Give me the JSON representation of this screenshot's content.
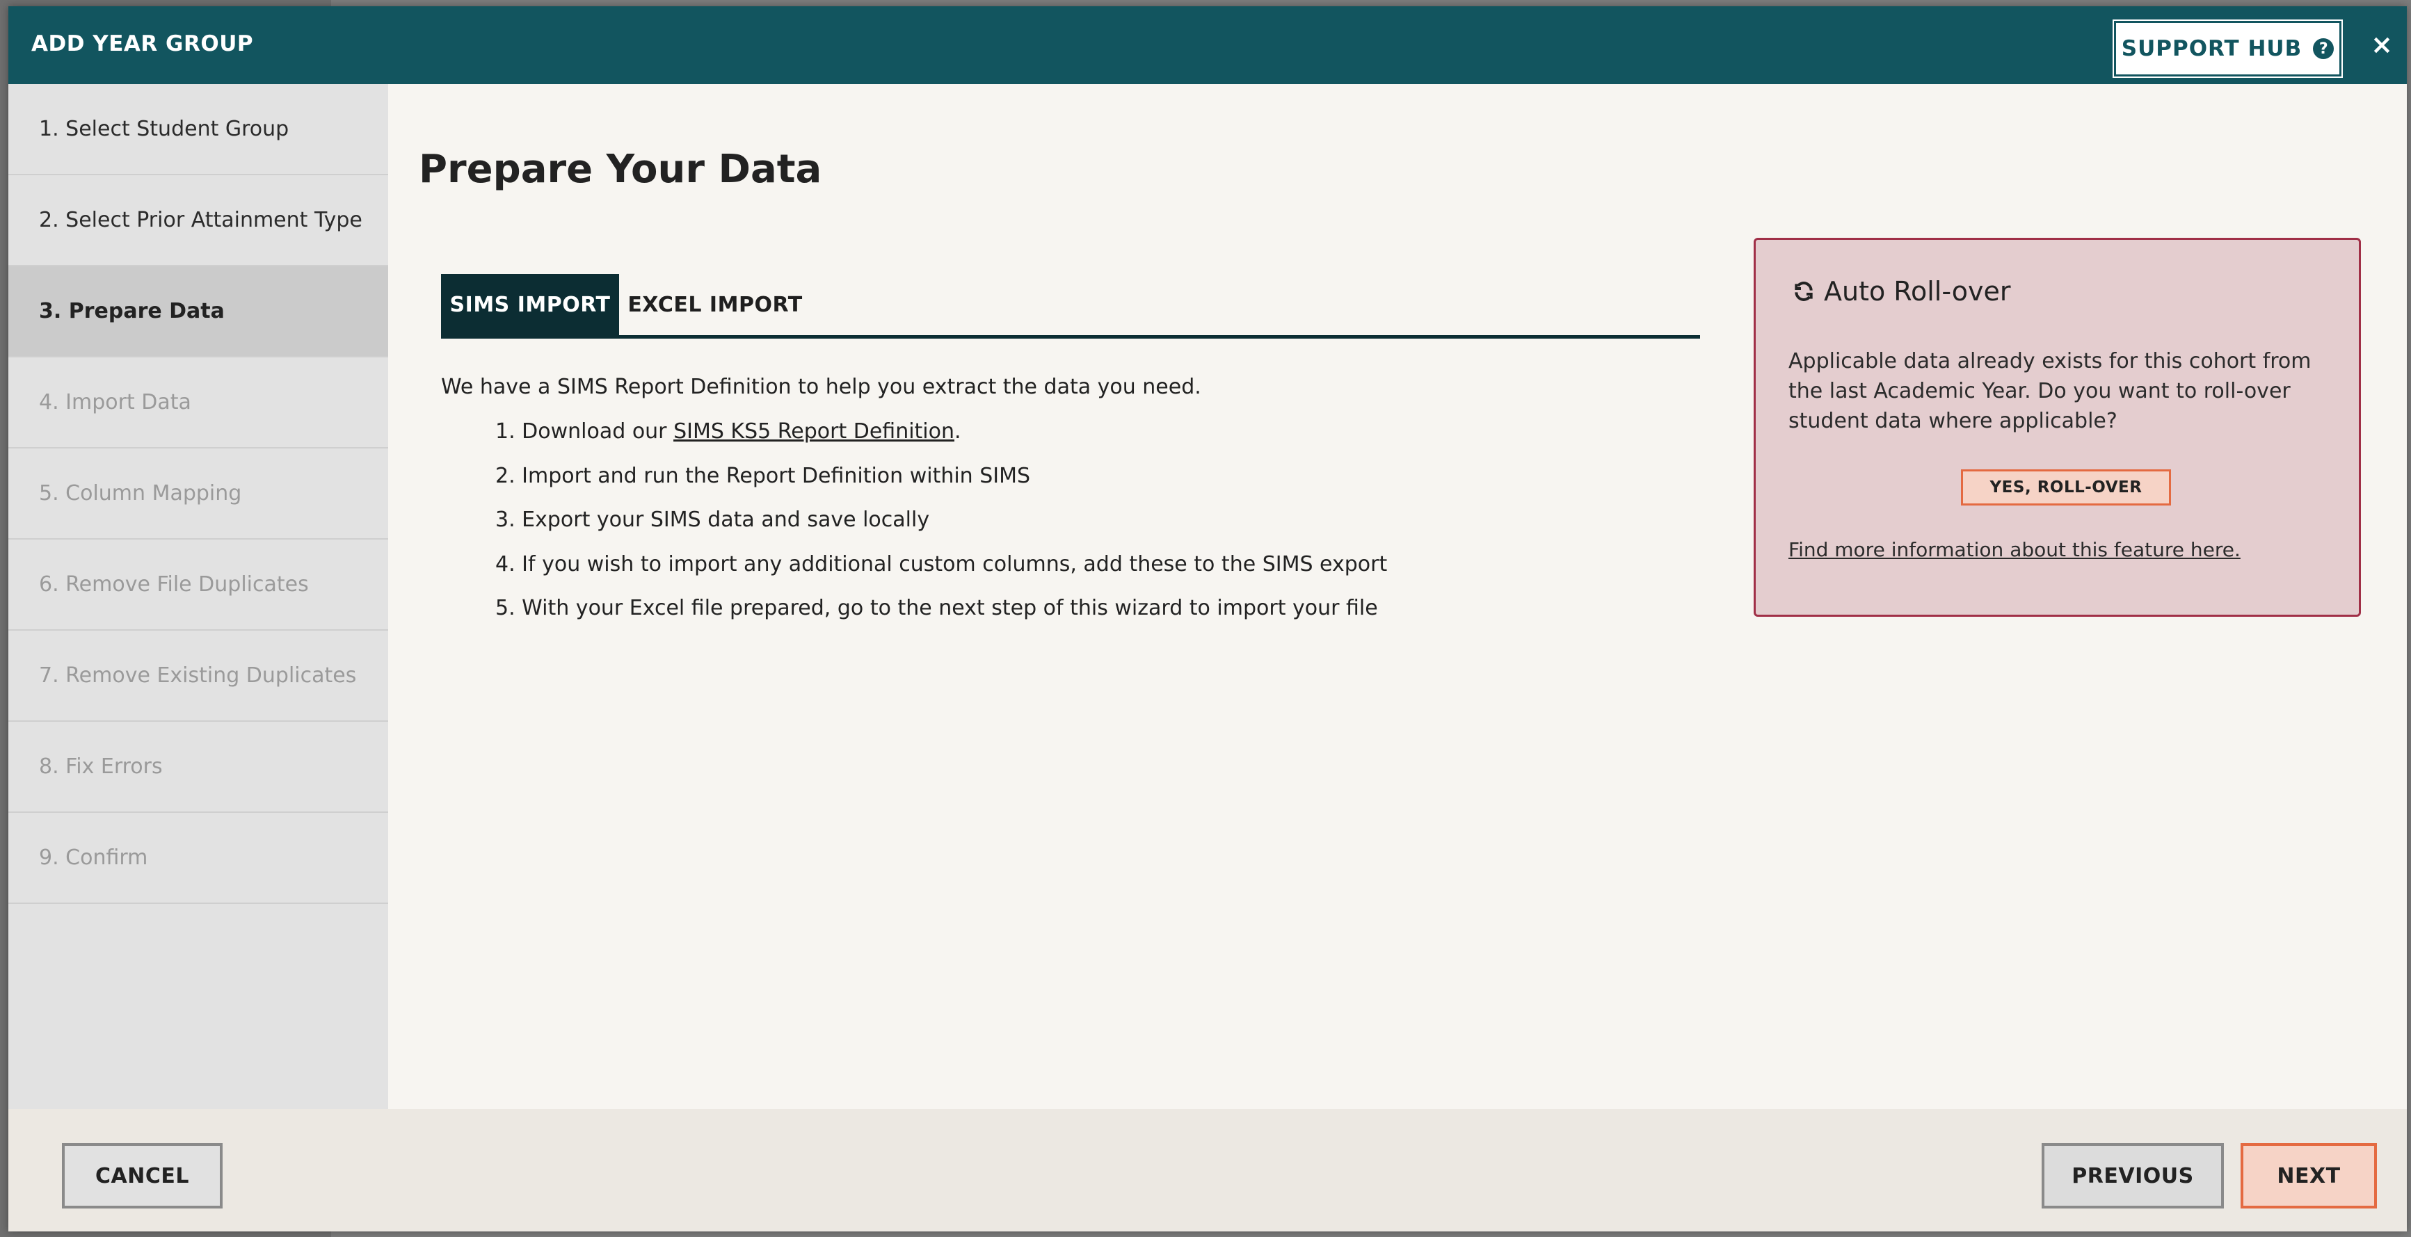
{
  "dialog": {
    "title": "ADD YEAR GROUP",
    "support_label": "SUPPORT HUB",
    "close_label": "×"
  },
  "steps": [
    {
      "label": "1. Select Student Group",
      "state": "done"
    },
    {
      "label": "2. Select Prior Attainment Type",
      "state": "done"
    },
    {
      "label": "3. Prepare Data",
      "state": "active"
    },
    {
      "label": "4. Import Data",
      "state": "disabled"
    },
    {
      "label": "5. Column Mapping",
      "state": "disabled"
    },
    {
      "label": "6. Remove File Duplicates",
      "state": "disabled"
    },
    {
      "label": "7. Remove Existing Duplicates",
      "state": "disabled"
    },
    {
      "label": "8. Fix Errors",
      "state": "disabled"
    },
    {
      "label": "9. Confirm",
      "state": "disabled"
    }
  ],
  "main": {
    "title": "Prepare Your Data",
    "tabs": [
      {
        "label": "SIMS IMPORT",
        "active": true
      },
      {
        "label": "EXCEL IMPORT",
        "active": false
      }
    ],
    "intro": "We have a SIMS Report Definition to help you extract the data you need.",
    "instructions": {
      "step1_prefix": "1. Download our ",
      "step1_link": "SIMS KS5 Report Definition",
      "step1_suffix": ".",
      "step2": "2. Import and run the Report Definition within SIMS",
      "step3": "3. Export your SIMS data and save locally",
      "step4": "4. If you wish to import any additional custom columns, add these to the SIMS export",
      "step5": "5. With your Excel file prepared, go to the next step of this wizard to import your file"
    }
  },
  "rollover": {
    "icon": "refresh-icon",
    "title": "Auto Roll-over",
    "text": "Applicable data already exists for this cohort from the last Academic Year. Do you want to roll-over student data where applicable?",
    "button": "YES, ROLL-OVER",
    "link": "Find more information about this feature here."
  },
  "footer": {
    "cancel": "CANCEL",
    "previous": "PREVIOUS",
    "next": "NEXT"
  },
  "colors": {
    "header": "#12555f",
    "active_tab": "#0c2d33",
    "rollover_border": "#a02f47",
    "accent_button": "#e46a41"
  }
}
